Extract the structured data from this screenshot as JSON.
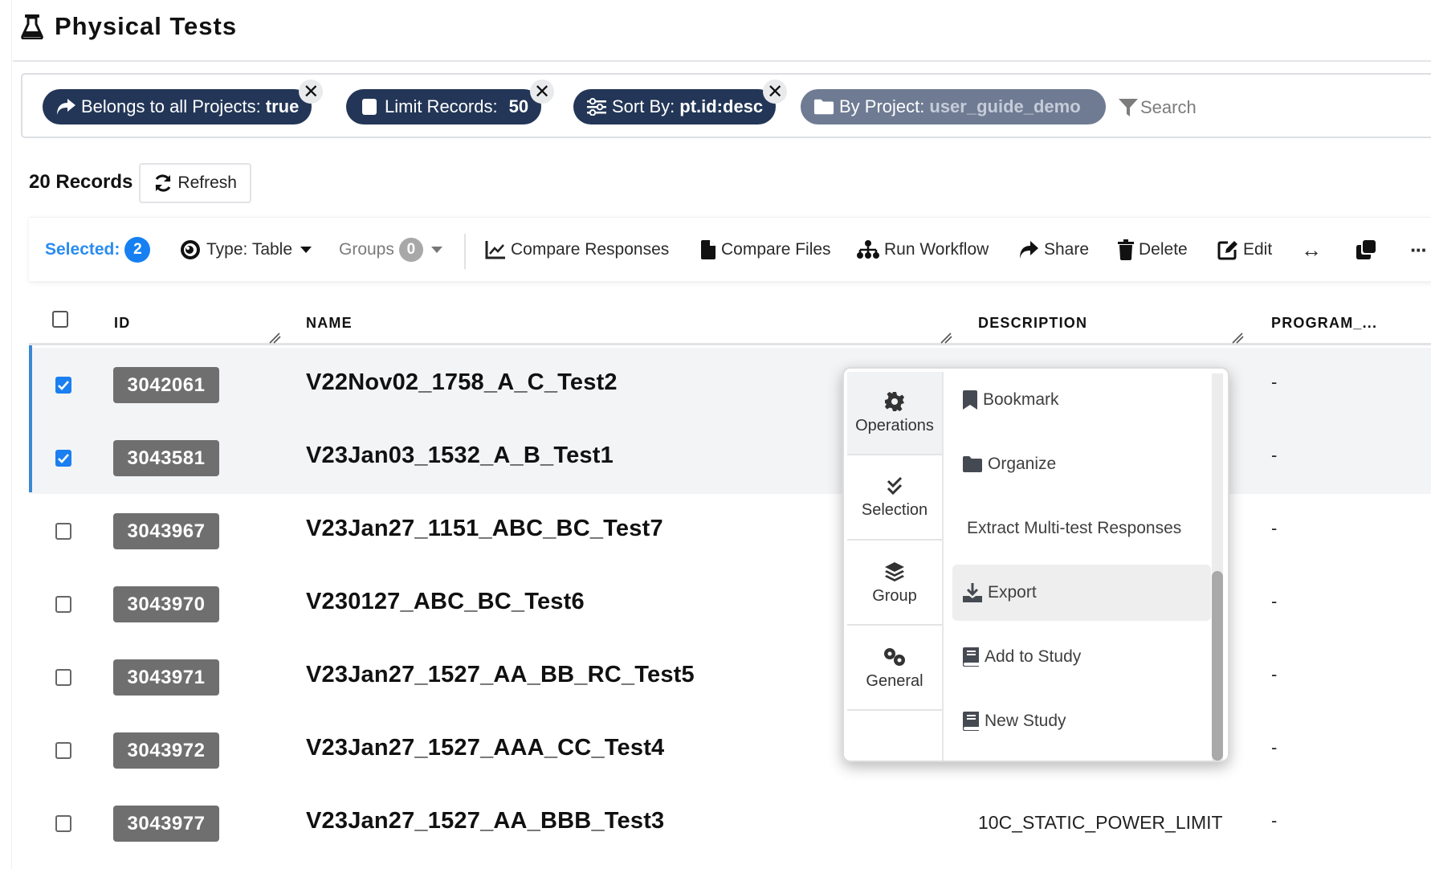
{
  "page": {
    "title": "Physical Tests",
    "title_icon": "flask-icon"
  },
  "filters": {
    "chips": [
      {
        "label": "Belongs to all Projects:",
        "value": "true",
        "icon": "share-arrow-icon",
        "removable": true
      },
      {
        "label": "Limit Records:",
        "value": "50",
        "icon": "square-icon",
        "removable": true
      },
      {
        "label": "Sort By:",
        "value": "pt.id:desc",
        "icon": "sliders-icon",
        "removable": true
      },
      {
        "label": "By Project:",
        "value": "user_guide_demo",
        "icon": "folder-icon",
        "removable": false
      }
    ],
    "remove_glyph": "✕",
    "search_label": "Search"
  },
  "records": {
    "count_label": "20 Records",
    "refresh_label": "Refresh"
  },
  "toolbar": {
    "selected_label": "Selected:",
    "selected_count": "2",
    "type_label": "Type: Table",
    "groups_label": "Groups",
    "groups_count": "0",
    "compare_responses": "Compare Responses",
    "compare_files": "Compare Files",
    "run_workflow": "Run Workflow",
    "share": "Share",
    "delete": "Delete",
    "edit": "Edit",
    "expand_glyph": "↔",
    "more_glyph": "···"
  },
  "table": {
    "columns": [
      "ID",
      "NAME",
      "DESCRIPTION",
      "PROGRAM_..."
    ],
    "rows": [
      {
        "id": "3042061",
        "name": "V22Nov02_1758_A_C_Test2",
        "description": "",
        "program": "-",
        "selected": true
      },
      {
        "id": "3043581",
        "name": "V23Jan03_1532_A_B_Test1",
        "description": "",
        "program": "-",
        "selected": true
      },
      {
        "id": "3043967",
        "name": "V23Jan27_1151_ABC_BC_Test7",
        "description": "",
        "program": "-",
        "selected": false
      },
      {
        "id": "3043970",
        "name": "V230127_ABC_BC_Test6",
        "description": "",
        "program": "-",
        "selected": false
      },
      {
        "id": "3043971",
        "name": "V23Jan27_1527_AA_BB_RC_Test5",
        "description": "",
        "program": "-",
        "selected": false
      },
      {
        "id": "3043972",
        "name": "V23Jan27_1527_AAA_CC_Test4",
        "description": "",
        "program": "-",
        "selected": false
      },
      {
        "id": "3043977",
        "name": "V23Jan27_1527_AA_BBB_Test3",
        "description": "10C_STATIC_POWER_LIMIT",
        "program": "-",
        "selected": false
      }
    ]
  },
  "popup": {
    "tabs": [
      {
        "label": "Operations",
        "icon": "gear-icon",
        "active": true
      },
      {
        "label": "Selection",
        "icon": "double-check-icon",
        "active": false
      },
      {
        "label": "Group",
        "icon": "layers-icon",
        "active": false
      },
      {
        "label": "General",
        "icon": "gears-icon",
        "active": false
      }
    ],
    "items": [
      {
        "label": "Bookmark",
        "icon": "bookmark-icon",
        "hover": false
      },
      {
        "label": "Organize",
        "icon": "folder-icon",
        "hover": false
      },
      {
        "label": "Extract Multi-test Responses",
        "icon": "",
        "hover": false
      },
      {
        "label": "Export",
        "icon": "download-icon",
        "hover": true
      },
      {
        "label": "Add to Study",
        "icon": "book-icon",
        "hover": false
      },
      {
        "label": "New Study",
        "icon": "book-icon",
        "hover": false
      }
    ]
  },
  "colors": {
    "chip_bg": "#233657",
    "chip_muted_bg": "#6e7b93",
    "accent_blue": "#1680f2",
    "selected_row_bg": "#f3f4f6",
    "id_badge_bg": "#6f6f6f"
  }
}
